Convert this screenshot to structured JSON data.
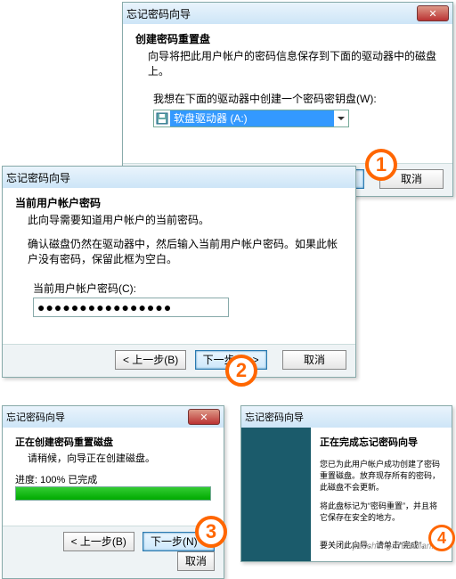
{
  "markers": {
    "m1": "1",
    "m2": "2",
    "m3": "3",
    "m4": "4"
  },
  "watermark": "jiaocheng.chazidian.com",
  "common": {
    "back_label": "< 上一步(B)",
    "next_label": "下一步(N) >",
    "cancel_label": "取消"
  },
  "w1": {
    "title": "忘记密码向导",
    "header": "创建密码重置盘",
    "desc": "向导将把此用户帐户的密码信息保存到下面的驱动器中的磁盘上。",
    "prompt": "我想在下面的驱动器中创建一个密码密钥盘(W):",
    "drive_selected": "软盘驱动器 (A:)"
  },
  "w2": {
    "title": "忘记密码向导",
    "header": "当前用户帐户密码",
    "sub": "此向导需要知道用户帐户的当前密码。",
    "note": "确认磁盘仍然在驱动器中，然后输入当前用户帐户密码。如果此帐户没有密码，保留此框为空白。",
    "field_label": "当前用户帐户密码(C):",
    "password_mask": "●●●●●●●●●●●●●●●●"
  },
  "w3": {
    "title": "忘记密码向导",
    "header": "正在创建密码重置磁盘",
    "sub": "请稍候，向导正在创建磁盘。",
    "progress_label": "进度: 100% 已完成",
    "progress_percent": 100
  },
  "w4": {
    "title": "忘记密码向导",
    "header": "正在完成忘记密码向导",
    "line1": "您已为此用户帐户成功创建了密码重置磁盘。放弃现存所有的密码，此磁盘不会更新。",
    "line2": "将此盘标记为“密码重置”，并且将它保存在安全的地方。",
    "line3": "要关闭此向导，请单击“完成”。"
  }
}
